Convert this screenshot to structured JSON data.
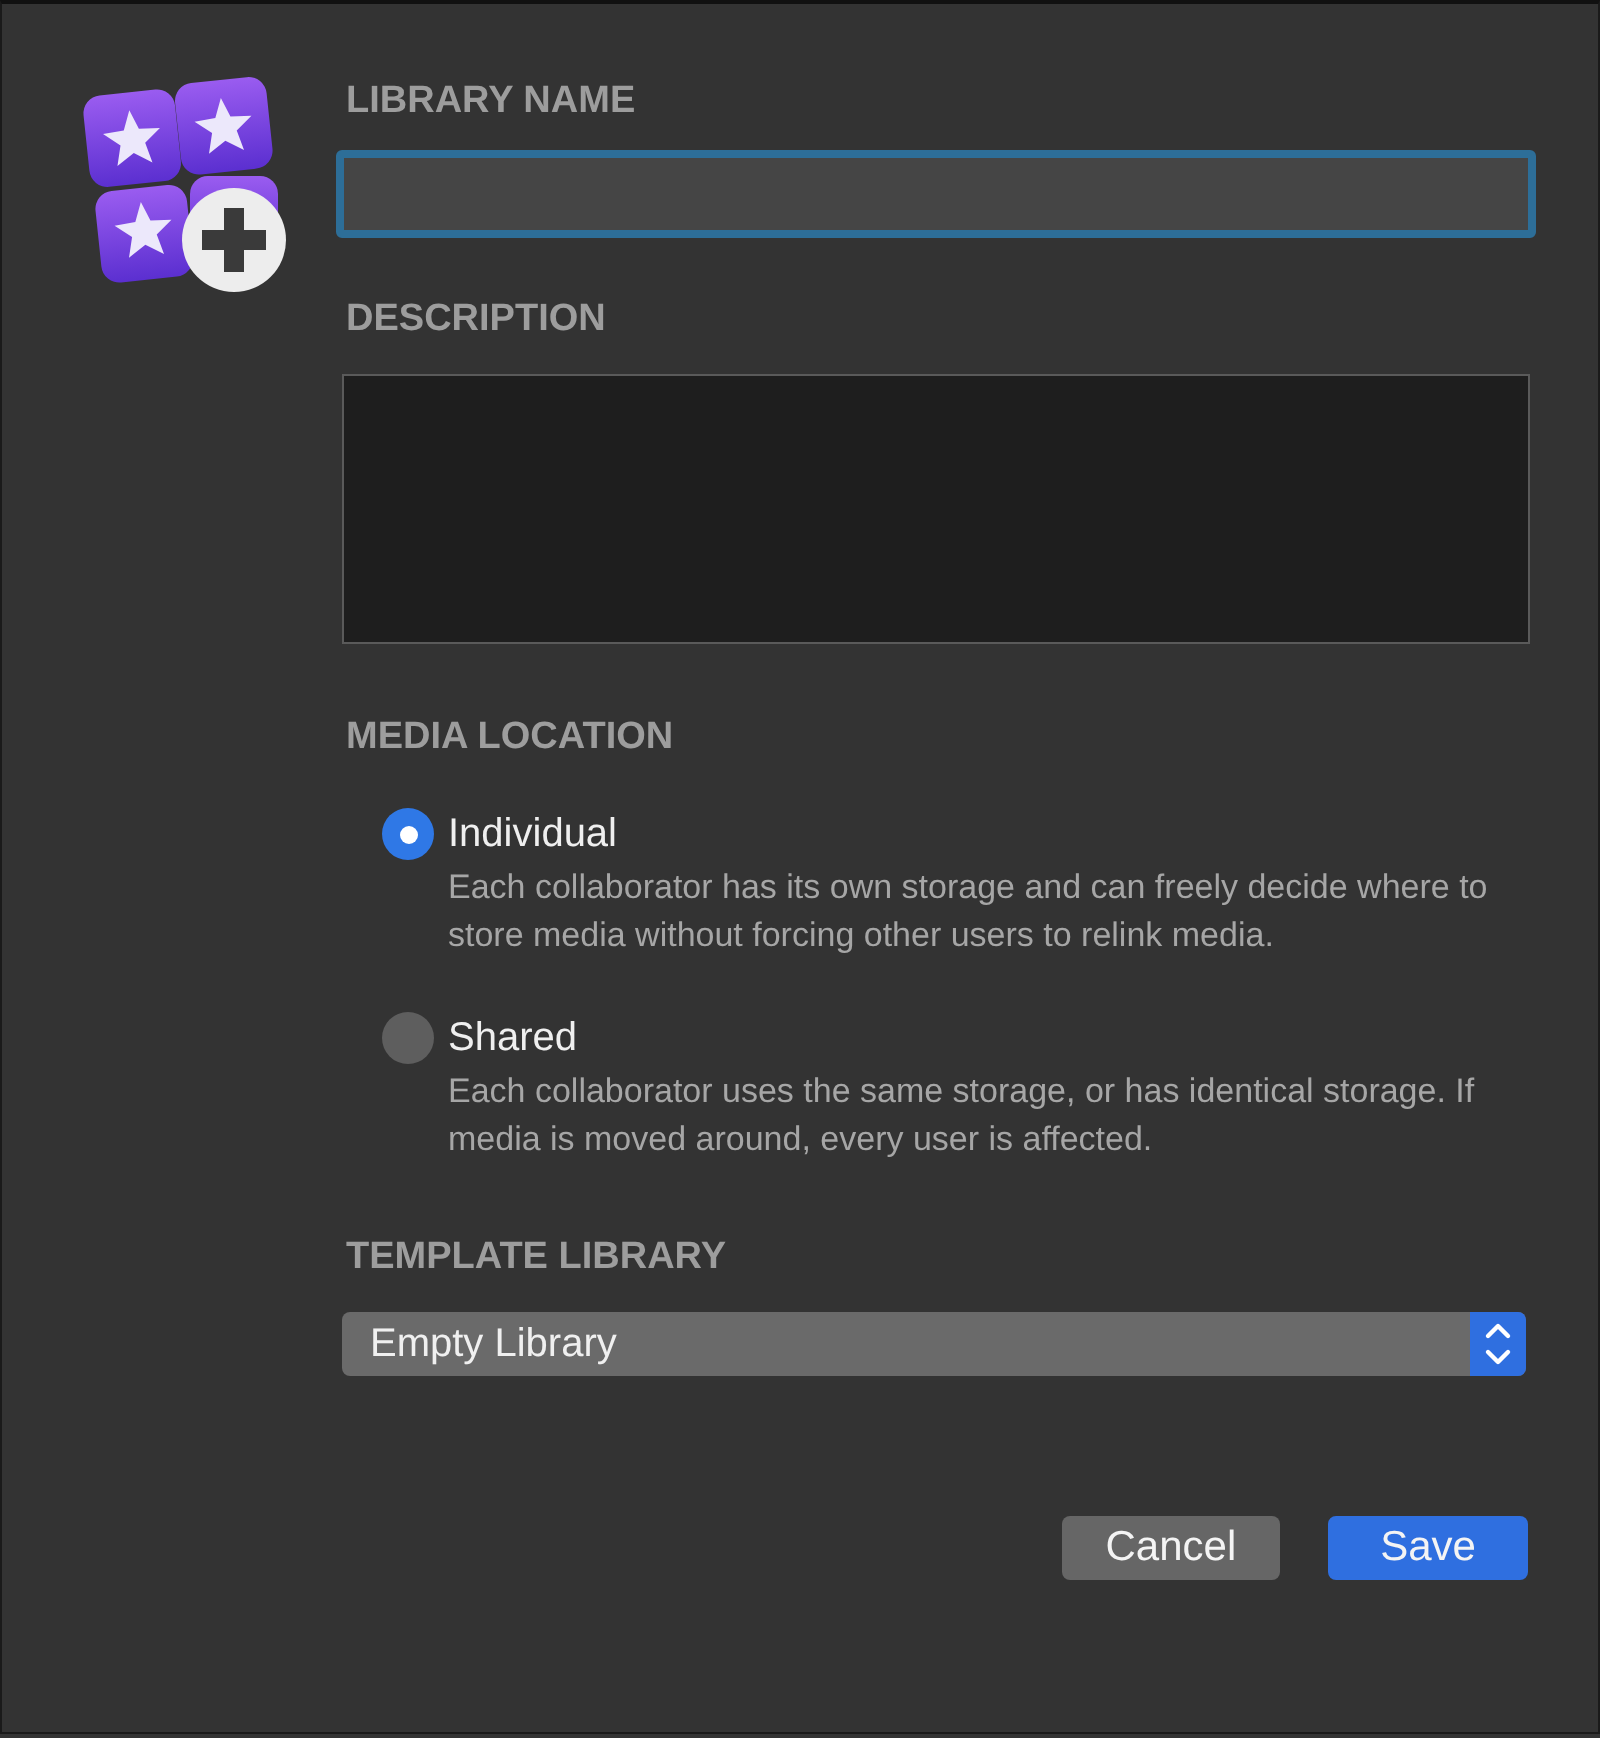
{
  "name_field": {
    "label": "LIBRARY NAME",
    "focused": true
  },
  "description_field": {
    "label": "DESCRIPTION"
  },
  "media_location": {
    "label": "MEDIA LOCATION",
    "options": [
      {
        "label": "Individual",
        "description": "Each collaborator has its own storage and can freely decide where to store media without forcing other users to relink media.",
        "selected": true
      },
      {
        "label": "Shared",
        "description": "Each collaborator uses the same storage, or has identical storage. If media is moved around, every user is affected.",
        "selected": false
      }
    ]
  },
  "template_library": {
    "label": "TEMPLATE LIBRARY",
    "value": "Empty Library"
  },
  "buttons": [
    {
      "label": "Cancel",
      "kind": "normal"
    },
    {
      "label": "Save",
      "kind": "default"
    }
  ]
}
